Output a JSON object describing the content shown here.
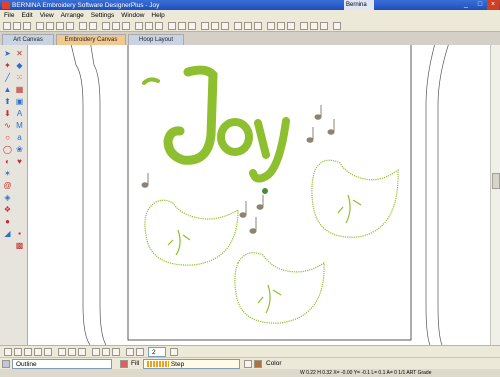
{
  "window": {
    "title": "BERNINA Embroidery Software DesignerPlus - Joy",
    "second_tab": "Bernina"
  },
  "menu": [
    "File",
    "Edit",
    "View",
    "Arrange",
    "Settings",
    "Window",
    "Help"
  ],
  "tabs": [
    {
      "label": "Art Canvas",
      "active": false
    },
    {
      "label": "Embroidery Canvas",
      "active": true
    },
    {
      "label": "Hoop Layout",
      "active": false
    }
  ],
  "design": {
    "word": "Joy",
    "thread_color": "#8dbf2e",
    "outline_color": "#8d9a6a"
  },
  "bottom": {
    "zoom_value": "2",
    "outline_label": "Outline",
    "fill_label": "Fill",
    "fill_type": "Step",
    "color_label": "Color"
  },
  "status": {
    "text": "W 0.22  H 0.32  X= -0.00 Y= -0.1 L= 0.1 A= 0  1/1  ART Grade"
  }
}
